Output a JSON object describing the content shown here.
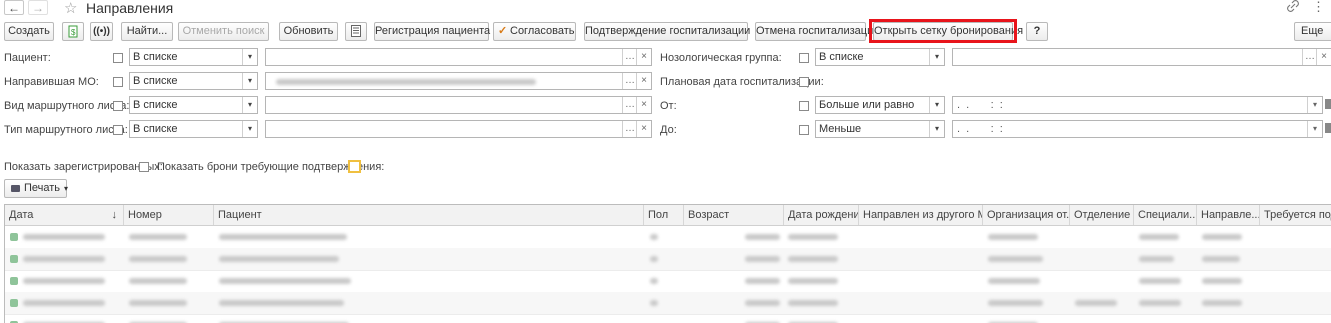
{
  "window": {
    "title": "Направления",
    "back": "←",
    "forward": "→",
    "star": "☆",
    "link": "🔗",
    "more": "⋮"
  },
  "toolbar": {
    "create": "Создать",
    "find": "Найти...",
    "cancel_search": "Отменить поиск",
    "refresh": "Обновить",
    "register_patient": "Регистрация пациента",
    "approve": "Согласовать",
    "confirm_hosp": "Подтверждение госпитализации",
    "cancel_hosp": "Отмена госпитализации",
    "open_booking": "Открыть сетку бронирования",
    "help": "?",
    "more": "Еще"
  },
  "filters": {
    "patient": {
      "label": "Пациент:",
      "mode": "В списке"
    },
    "mo": {
      "label": "Направившая МО:",
      "mode": "В списке"
    },
    "route_kind": {
      "label": "Вид маршрутного листа:",
      "mode": "В списке"
    },
    "route_type": {
      "label": "Тип маршрутного листа:",
      "mode": "В списке"
    },
    "nosology": {
      "label": "Нозологическая группа:",
      "mode": "В списке"
    },
    "planned_date": {
      "label": "Плановая дата госпитализации:"
    },
    "from": {
      "label": "От:",
      "mode": "Больше или равно",
      "value": ".  .       :  :"
    },
    "to": {
      "label": "До:",
      "mode": "Меньше",
      "value": ".  .       :  :"
    }
  },
  "options": {
    "show_registered": "Показать зарегистрированных:",
    "show_bookings": "Показать брони требующие подтверждения:"
  },
  "print": {
    "label": "Печать"
  },
  "table": {
    "columns": [
      "Дата",
      "Номер",
      "Пациент",
      "Пол",
      "Возраст",
      "Дата рождения",
      "Направлен из другого МО",
      "Организация от...",
      "Отделение",
      "Специали...",
      "Направле...",
      "Требуется подте"
    ],
    "sort_indicator": "↓"
  },
  "colors": {
    "highlight": "#e8141b",
    "header_bg": "#f2f2f2"
  }
}
